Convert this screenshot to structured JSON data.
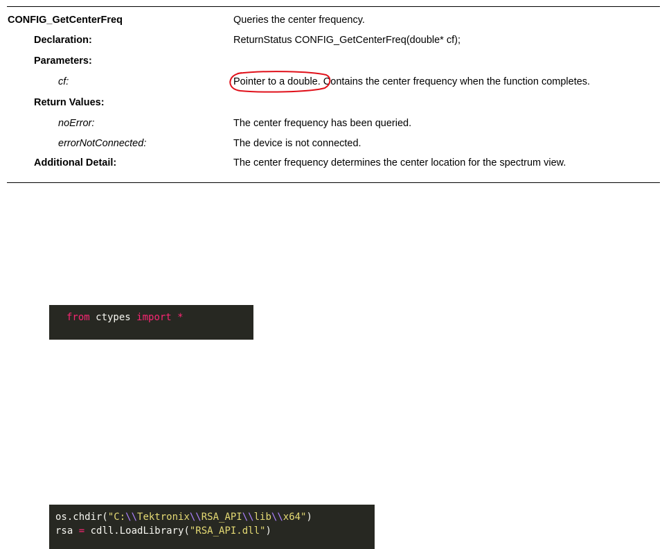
{
  "spec": {
    "function_name": "CONFIG_GetCenterFreq",
    "summary": "Queries the center frequency.",
    "declaration_label": "Declaration:",
    "declaration": "ReturnStatus CONFIG_GetCenterFreq(double* cf);",
    "parameters_label": "Parameters:",
    "param_name": "cf:",
    "param_desc_circled": "Pointer to a double.",
    "param_desc_rest": " Contains the center frequency when the function completes.",
    "return_values_label": "Return Values:",
    "rv1_name": "noError:",
    "rv1_desc": "The center frequency has been queried.",
    "rv2_name": "errorNotConnected:",
    "rv2_desc": "The device is not connected.",
    "additional_label": "Additional Detail:",
    "additional_desc": "The center frequency determines the center location for the spectrum view.",
    "annotation_color": "#e0101a"
  },
  "code1": {
    "kw_from": "from",
    "module": " ctypes ",
    "kw_import": "import",
    "star": " *"
  },
  "code2": {
    "line1_prefix": "os.chdir(",
    "line1_str_a": "\"C:",
    "line1_esc_1": "\\\\",
    "line1_str_b": "Tektronix",
    "line1_esc_2": "\\\\",
    "line1_str_c": "RSA_API",
    "line1_esc_3": "\\\\",
    "line1_str_d": "lib",
    "line1_esc_4": "\\\\",
    "line1_str_e": "x64\"",
    "line1_suffix": ")",
    "line2_var": "rsa ",
    "line2_eq": "=",
    "line2_call": " cdll.LoadLibrary(",
    "line2_str": "\"RSA_API.dll\"",
    "line2_suffix": ")"
  },
  "colors": {
    "code_bg": "#272822",
    "keyword": "#f92672",
    "string": "#e6db74",
    "escape": "#ae81ff",
    "text": "#f8f8f2"
  }
}
